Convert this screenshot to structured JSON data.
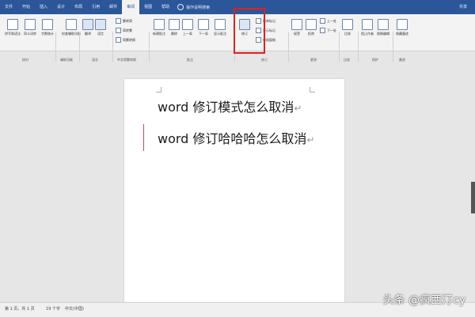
{
  "title_bar": {
    "tabs": [
      "文件",
      "开始",
      "插入",
      "设计",
      "布局",
      "引用",
      "邮件",
      "审阅",
      "视图",
      "帮助"
    ],
    "active_tab_index": 7,
    "tell_me": "操作说明搜索",
    "user": "共享",
    "accent_color": "#2b579a"
  },
  "ribbon": {
    "spelling": "拼写和语法",
    "thesaurus": "同义词库",
    "word_count": "字数统计",
    "check_accessibility": "检查辅助功能",
    "translate": "翻译",
    "language": "语言",
    "simp_to_trad": "繁转简",
    "trad_to_simp": "简转繁",
    "conversion": "简繁转换",
    "new_comment": "新建批注",
    "delete": "删除",
    "previous": "上一条",
    "next": "下一条",
    "show_comments": "显示批注",
    "track_changes": "修订",
    "simple_markup": "简单标记",
    "show_markup": "显示标记",
    "reviewing_pane": "审阅窗格",
    "accept": "接受",
    "reject": "拒绝",
    "prev_change": "上一处",
    "next_change": "下一处",
    "compare": "比较",
    "block_authors": "阻止作者",
    "restrict_editing": "限制编辑",
    "hide_ink": "隐藏墨迹",
    "groups": {
      "proofing": "校对",
      "accessibility": "辅助功能",
      "language": "语言",
      "chinese_conversion": "中文简繁转换",
      "comments": "批注",
      "tracking": "修订",
      "changes": "更改",
      "compare": "比较",
      "protect": "保护",
      "ink": "墨迹"
    }
  },
  "document": {
    "line1": "word 修订模式怎么取消",
    "line2": "word 修订哈哈哈怎么取消",
    "paragraph_mark": "↵"
  },
  "status_bar": {
    "page": "第 1 页，共 1 页",
    "words": "19 个字",
    "language": "中文(中国)"
  },
  "watermark": "头条 @疯西汀cy"
}
